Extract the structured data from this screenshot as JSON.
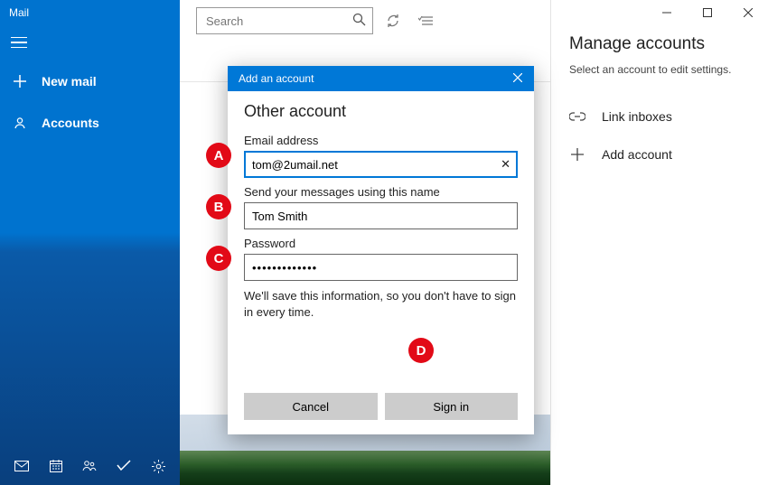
{
  "app": {
    "title": "Mail"
  },
  "sidebar": {
    "new_mail": "New mail",
    "accounts": "Accounts"
  },
  "search": {
    "placeholder": "Search"
  },
  "right": {
    "title": "Manage accounts",
    "subtitle": "Select an account to edit settings.",
    "link_inboxes": "Link inboxes",
    "add_account": "Add account"
  },
  "dialog": {
    "titlebar": "Add an account",
    "heading": "Other account",
    "email_label": "Email address",
    "email_value": "tom@2umail.net",
    "name_label": "Send your messages using this name",
    "name_value": "Tom Smith",
    "password_label": "Password",
    "password_value": "•••••••••••••",
    "save_note": "We'll save this information, so you don't have to sign in every time.",
    "cancel": "Cancel",
    "sign_in": "Sign in"
  },
  "annotations": {
    "A": "A",
    "B": "B",
    "C": "C",
    "D": "D"
  },
  "window": {
    "min": "—",
    "max": "▢",
    "close": "✕"
  }
}
